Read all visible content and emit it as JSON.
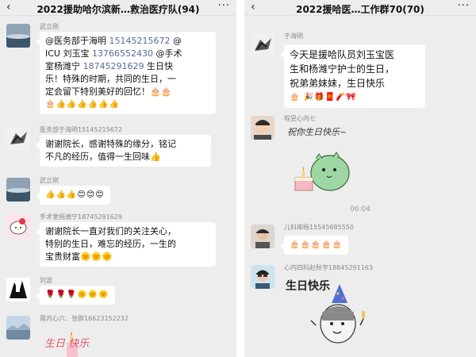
{
  "left": {
    "header": {
      "back_icon": "chevron-left-icon",
      "title": "2022援助哈尔滨新…救治医疗队(94)",
      "more_icon": "more-icon"
    },
    "messages": [
      {
        "sender": "武立刚",
        "line1": "@医务部于海明 ",
        "phone1": "15145215672",
        "line1b": " @",
        "line2": "ICU 刘玉宝 ",
        "phone2": "13766552430",
        "line2b": " @手术",
        "line3": "室杨潍宁 ",
        "phone3": "18745291629",
        "line3b": " 生日快",
        "line4": "乐！特殊的时期，共同的生日，一",
        "line5": "定会留下特别美好的回忆！🎂🎂",
        "line6": "🎂👍👍👍👍👍👍"
      },
      {
        "sender": "医务部于海明15145215672",
        "line1": "谢谢院长，感谢特殊的缘分，铭记",
        "line2": "不凡的经历，值得一生回味👍"
      },
      {
        "sender": "武立刚",
        "line1": "👍👍👍😊😊😊"
      },
      {
        "sender": "手术室杨潍宁18745291629",
        "line1": "谢谢院长一直对我们的关注关心，",
        "line2": "特别的生日，难忘的经历，一生的",
        "line3": "宝贵财富🌞🌞🌞"
      },
      {
        "sender": "刘波",
        "line1": "🌹🌹🌹🌞🌞🌞"
      },
      {
        "sender": "胃内心六、张群16623152232",
        "sticker_text": "生日 快乐"
      }
    ]
  },
  "right": {
    "header": {
      "back_icon": "chevron-left-icon",
      "title": "2022援哈医…工作群70(70)",
      "more_icon": "more-icon"
    },
    "messages": [
      {
        "sender": "于海明",
        "line1": "今天是援哈队员刘玉宝医",
        "line2": "生和杨潍宁护士的生日，",
        "line3": "祝弟弟妹妹，生日快乐",
        "line4": "🎂 🎉🎁🧧🧨🎀"
      },
      {
        "sender": "程昱心内七",
        "sticker_text": "祝你生日快乐~"
      },
      {
        "time": "06:04"
      },
      {
        "sender": "儿科柳杨15545685550",
        "line1": "🎂🎂🎂🎂🎂"
      },
      {
        "sender": "心内四科赵秋宇18845291163",
        "sticker_text": "生日快乐"
      }
    ]
  },
  "colors": {
    "background": "#ededed",
    "bubble": "#ffffff",
    "link": "#576b95",
    "timestamp": "#9a9a9a"
  }
}
